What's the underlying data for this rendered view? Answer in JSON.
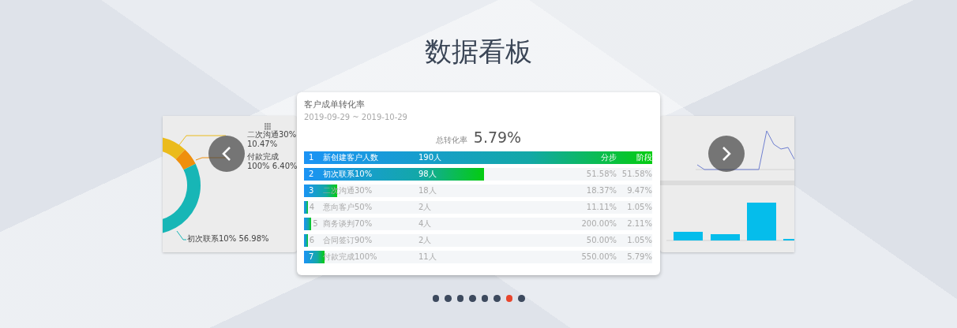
{
  "title": "数据看板",
  "left_slide": {
    "labels": [
      {
        "text": "二次沟通30% 10.47%"
      },
      {
        "text": "付款完成100% 6.40%"
      },
      {
        "text": "初次联系10% 56.98%"
      }
    ]
  },
  "main_slide": {
    "title": "客户成单转化率",
    "date_range": "2019-09-29 ~ 2019-10-29",
    "total_label": "总转化率",
    "total_value": "5.79%",
    "rows": [
      {
        "index": "1",
        "name": "新创建客户人数",
        "count": "190人",
        "step_rate": "分步",
        "stage_rate": "阶段",
        "level": 1
      },
      {
        "index": "2",
        "name": "初次联系10%",
        "count": "98人",
        "step_rate": "51.58%",
        "stage_rate": "51.58%",
        "level": 0.516
      },
      {
        "index": "3",
        "name": "二次沟通30%",
        "count": "18人",
        "step_rate": "18.37%",
        "stage_rate": "9.47%",
        "level": 0.095
      },
      {
        "index": "4",
        "name": "意向客户50%",
        "count": "2人",
        "step_rate": "11.11%",
        "stage_rate": "1.05%",
        "level": 0.011
      },
      {
        "index": "5",
        "name": "商务谈判70%",
        "count": "4人",
        "step_rate": "200.00%",
        "stage_rate": "2.11%",
        "level": 0.021
      },
      {
        "index": "6",
        "name": "合同签订90%",
        "count": "2人",
        "step_rate": "50.00%",
        "stage_rate": "1.05%",
        "level": 0.011
      },
      {
        "index": "7",
        "name": "付款完成100%",
        "count": "11人",
        "step_rate": "550.00%",
        "stage_rate": "5.79%",
        "level": 0.058
      }
    ]
  },
  "pager": [
    {
      "selected": false
    },
    {
      "selected": false
    },
    {
      "selected": false
    },
    {
      "selected": false
    },
    {
      "selected": false
    },
    {
      "selected": false
    },
    {
      "selected": true
    },
    {
      "selected": false
    }
  ]
}
